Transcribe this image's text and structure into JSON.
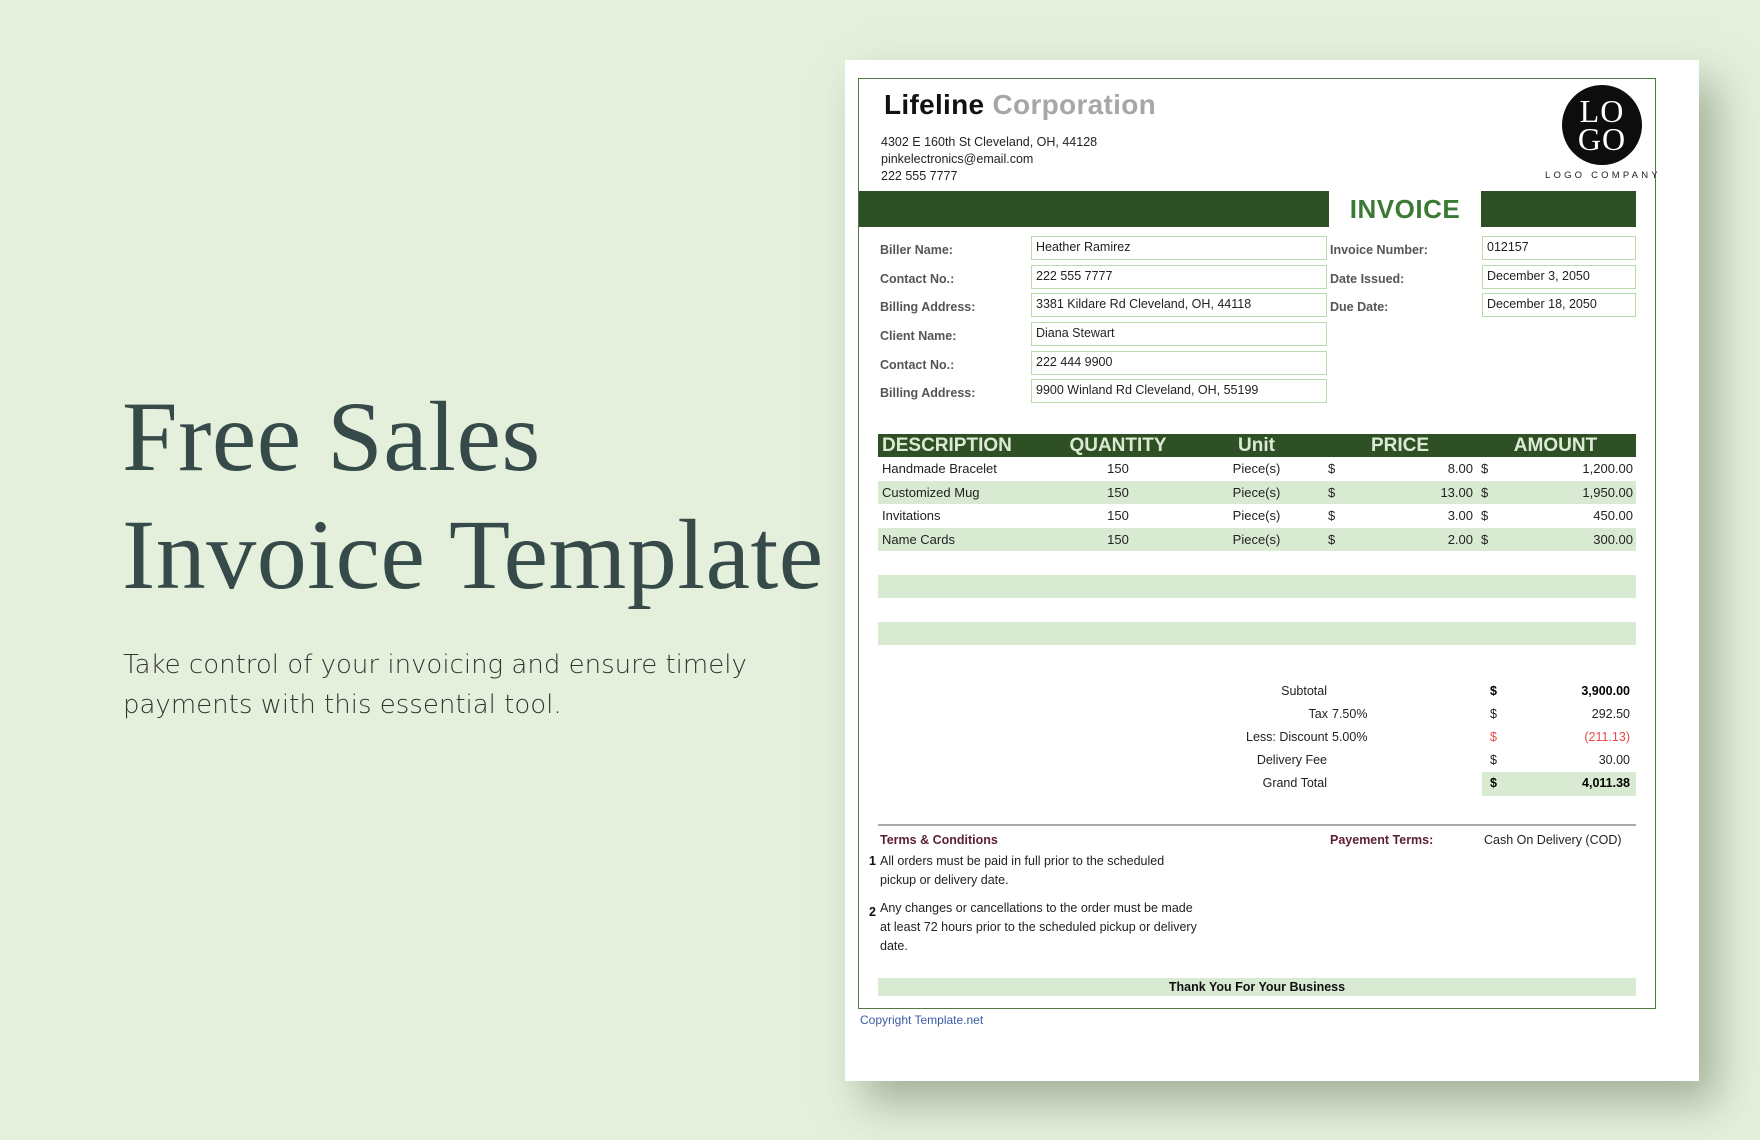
{
  "hero": {
    "title_line1": "Free Sales",
    "title_line2": "Invoice Template",
    "subtitle": "Take control of your invoicing and ensure timely payments with this essential tool."
  },
  "invoice": {
    "company_name_bold": "Lifeline",
    "company_name_light": "Corporation",
    "address": "4302 E 160th St Cleveland, OH, 44128",
    "email": "pinkelectronics@email.com",
    "phone": "222 555 7777",
    "logo_text_line1": "LO",
    "logo_text_line2": "GO",
    "logo_caption": "LOGO COMPANY",
    "title": "INVOICE",
    "biller_fields": [
      {
        "label": "Biller Name:",
        "value": "Heather Ramirez"
      },
      {
        "label": "Contact No.:",
        "value": "222 555 7777"
      },
      {
        "label": "Billing Address:",
        "value": "3381 Kildare Rd Cleveland, OH, 44118"
      },
      {
        "label": "Client Name:",
        "value": "Diana Stewart"
      },
      {
        "label": "Contact No.:",
        "value": "222 444 9900"
      },
      {
        "label": "Billing Address:",
        "value": "9900 Winland Rd Cleveland, OH, 55199"
      }
    ],
    "meta_fields": [
      {
        "label": "Invoice Number:",
        "value": "012157"
      },
      {
        "label": "Date Issued:",
        "value": "December 3, 2050"
      },
      {
        "label": "Due Date:",
        "value": "December 18, 2050"
      }
    ],
    "table": {
      "headers": [
        "DESCRIPTION",
        "QUANTITY",
        "Unit",
        "PRICE",
        "AMOUNT"
      ],
      "currency": "$",
      "rows": [
        {
          "description": "Handmade Bracelet",
          "quantity": "150",
          "unit": "Piece(s)",
          "price": "8.00",
          "amount": "1,200.00"
        },
        {
          "description": "Customized Mug",
          "quantity": "150",
          "unit": "Piece(s)",
          "price": "13.00",
          "amount": "1,950.00"
        },
        {
          "description": "Invitations",
          "quantity": "150",
          "unit": "Piece(s)",
          "price": "3.00",
          "amount": "450.00"
        },
        {
          "description": "Name Cards",
          "quantity": "150",
          "unit": "Piece(s)",
          "price": "2.00",
          "amount": "300.00"
        }
      ]
    },
    "totals": {
      "subtotal_label": "Subtotal",
      "subtotal": "3,900.00",
      "tax_label": "Tax",
      "tax_rate": "7.50%",
      "tax": "292.50",
      "discount_label": "Less: Discount",
      "discount_rate": "5.00%",
      "discount": "(211.13)",
      "delivery_label": "Delivery  Fee",
      "delivery": "30.00",
      "grand_total_label": "Grand Total",
      "grand_total": "4,011.38",
      "currency": "$"
    },
    "terms": {
      "heading": "Terms & Conditions",
      "items": [
        {
          "num": "1",
          "text": "All orders must be paid in full prior to the scheduled pickup or delivery date."
        },
        {
          "num": "2",
          "text": "Any changes or cancellations to the order must be made at least 72 hours prior to the scheduled pickup or delivery date."
        }
      ],
      "payment_label": "Payement Terms:",
      "payment_value": "Cash On Delivery (COD)"
    },
    "thanks": "Thank You For Your Business",
    "copyright": "Copyright Template.net"
  },
  "colors": {
    "background": "#e5f0dc",
    "brand_dark_green": "#2f5024",
    "accent_green": "#3a7a34",
    "row_tint": "#d9ead3",
    "field_border": "#b9dcae",
    "discount_red": "#e84a4a",
    "terms_heading": "#5a1f34"
  }
}
